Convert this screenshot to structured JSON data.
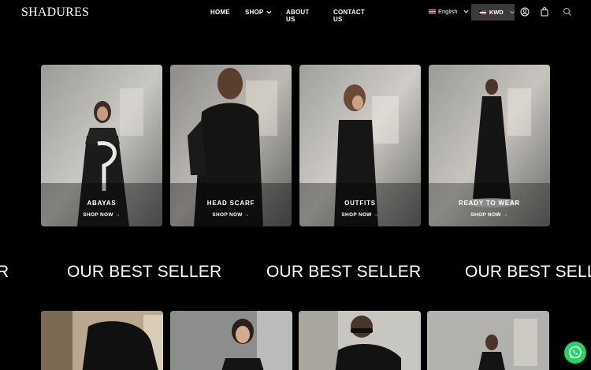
{
  "header": {
    "logo": "SHADURES",
    "nav": [
      {
        "label": "HOME"
      },
      {
        "label": "SHOP"
      },
      {
        "label": "ABOUT US"
      },
      {
        "label": "CONTACT US"
      }
    ],
    "language": "English",
    "currency": "KWD"
  },
  "categories": [
    {
      "title": "ABAYAS",
      "link": "SHOP NOW →"
    },
    {
      "title": "HEAD SCARF",
      "link": "SHOP NOW →"
    },
    {
      "title": "OUTFITS",
      "link": "SHOP NOW →"
    },
    {
      "title": "READY TO WEAR",
      "link": "SHOP NOW →"
    }
  ],
  "marquee": {
    "partial": "R",
    "text": "OUR BEST SELLER",
    "tail": "OUR BEST SELLE"
  },
  "colors": {
    "background": "#000000",
    "whatsapp": "#25d366",
    "currency_bg": "#3a3a3a"
  }
}
